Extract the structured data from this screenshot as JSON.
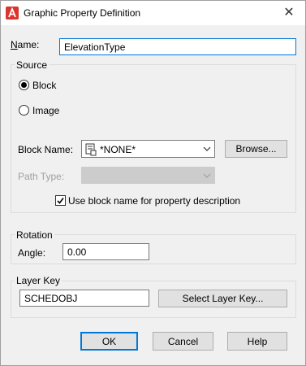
{
  "window": {
    "title": "Graphic Property Definition",
    "close_glyph": "✕",
    "app_icon": "autocad-a-icon"
  },
  "name_field": {
    "label": "Name:",
    "value": "ElevationType"
  },
  "source": {
    "group_title": "Source",
    "block_radio_label": "Block",
    "image_radio_label": "Image",
    "selected": "Block",
    "block_name_label": "Block Name:",
    "block_name_value": "*NONE*",
    "browse_label": "Browse...",
    "path_type_label": "Path Type:",
    "path_type_value": "",
    "use_block_name_label": "Use block name for property description",
    "use_block_name_checked": true
  },
  "rotation": {
    "group_title": "Rotation",
    "angle_label": "Angle:",
    "angle_value": "0.00"
  },
  "layer_key": {
    "group_title": "Layer Key",
    "value": "SCHEDOBJ",
    "select_label": "Select Layer Key..."
  },
  "buttons": {
    "ok": "OK",
    "cancel": "Cancel",
    "help": "Help"
  },
  "colors": {
    "accent": "#0078d7",
    "app_icon_red": "#d8362f"
  }
}
